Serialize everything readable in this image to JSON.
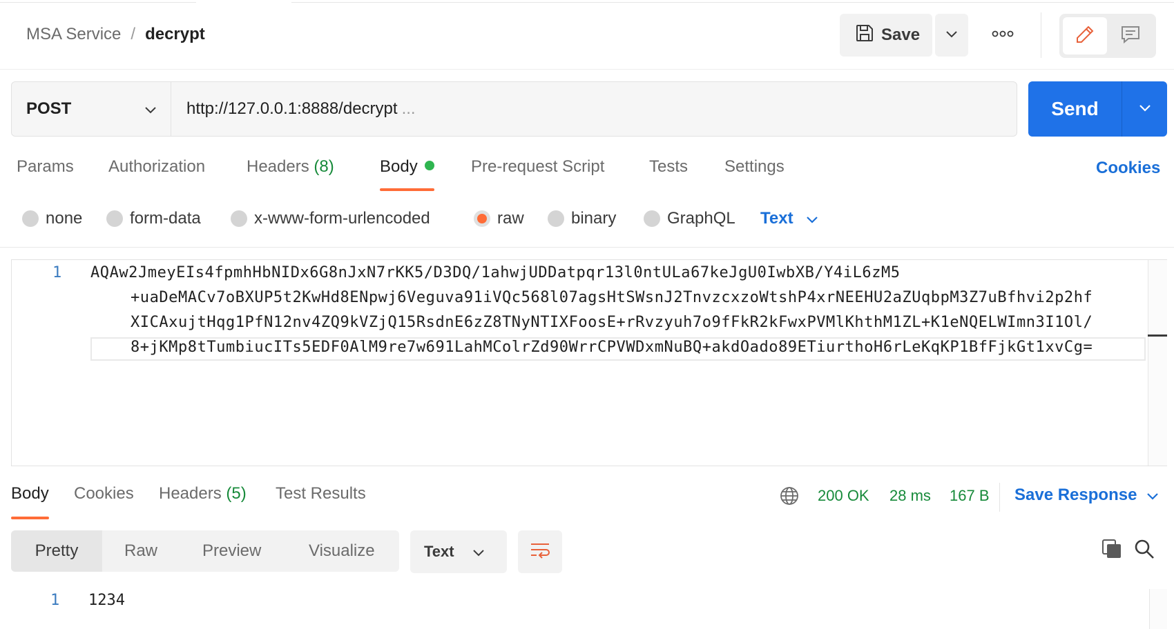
{
  "breadcrumb": {
    "collection": "MSA Service",
    "separator": "/",
    "request": "decrypt"
  },
  "toolbar": {
    "save_label": "Save",
    "more_glyph": "ooo"
  },
  "request": {
    "method": "POST",
    "url": "http://127.0.0.1:8888/decrypt",
    "url_ellipsis": "...",
    "send_label": "Send"
  },
  "req_tabs": {
    "params": "Params",
    "authorization": "Authorization",
    "headers_label": "Headers",
    "headers_count": "(8)",
    "body": "Body",
    "prerequest": "Pre-request Script",
    "tests": "Tests",
    "settings": "Settings",
    "cookies": "Cookies"
  },
  "body_types": {
    "none": "none",
    "form_data": "form-data",
    "urlencoded": "x-www-form-urlencoded",
    "raw": "raw",
    "binary": "binary",
    "graphql": "GraphQL",
    "selected": "raw",
    "format": "Text"
  },
  "editor": {
    "line_number": "1",
    "lines": [
      "AQAw2JmeyEIs4fpmhHbNIDx6G8nJxN7rKK5/D3DQ/1ahwjUDDatpqr13l0ntULa67keJgU0IwbXB/Y4iL6zM5",
      "+uaDeMACv7oBXUP5t2KwHd8ENpwj6Veguva91iVQc568l07agsHtSWsnJ2TnvzcxzoWtshP4xrNEEHU2aZUqbpM3Z7uBfhvi2p2hf",
      "XICAxujtHqg1PfN12nv4ZQ9kVZjQ15RsdnE6zZ8TNyNTIXFoosE+rRvzyuh7o9fFkR2kFwxPVMlKhthM1ZL+K1eNQELWImn3I1Ol/",
      "8+jKMp8tTumbiucITs5EDF0AlM9re7w691LahMColrZd90WrrCPVWDxmNuBQ+akdOado89ETiurthoH6rLeKqKP1BfFjkGt1xvCg="
    ]
  },
  "response": {
    "tabs": {
      "body": "Body",
      "cookies": "Cookies",
      "headers_label": "Headers",
      "headers_count": "(5)",
      "test_results": "Test Results"
    },
    "status": "200 OK",
    "time": "28 ms",
    "size": "167 B",
    "save_response": "Save Response",
    "views": {
      "pretty": "Pretty",
      "raw": "Raw",
      "preview": "Preview",
      "visualize": "Visualize"
    },
    "format": "Text",
    "line_number": "1",
    "body_text": "1234"
  },
  "colors": {
    "accent": "#ff6c37",
    "send": "#1f72e8",
    "link": "#1a6fd8",
    "success": "#178a3a"
  }
}
